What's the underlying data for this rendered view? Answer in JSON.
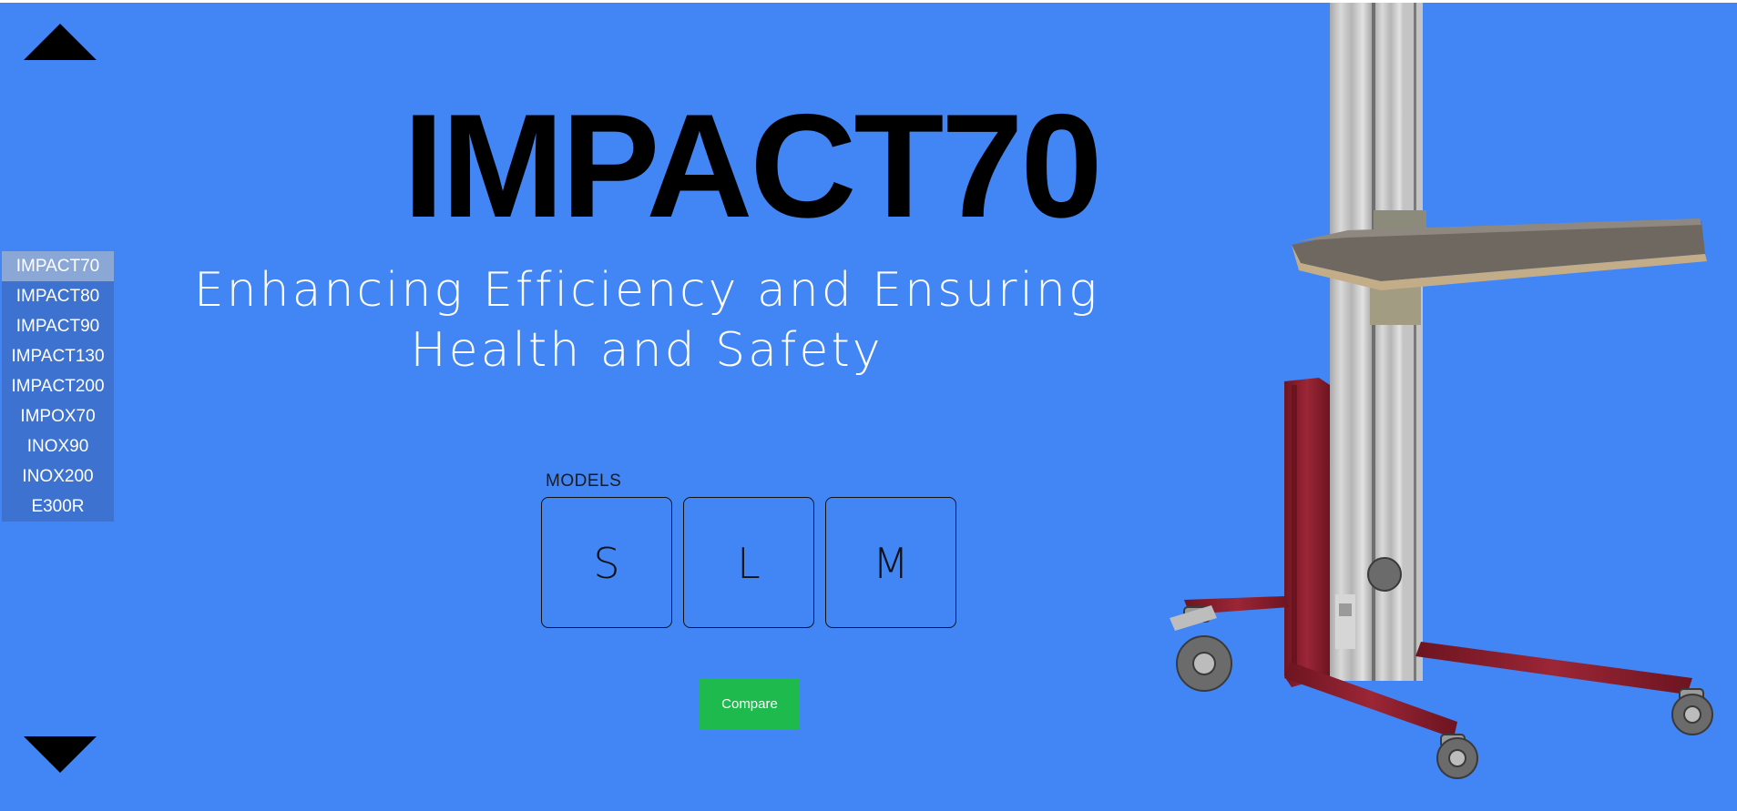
{
  "product": {
    "title": "IMPACT70",
    "subtitle": "Enhancing Efficiency and Ensuring Health and Safety"
  },
  "sidebar": {
    "items": [
      {
        "label": "IMPACT70",
        "active": true
      },
      {
        "label": "IMPACT80",
        "active": false
      },
      {
        "label": "IMPACT90",
        "active": false
      },
      {
        "label": "IMPACT130",
        "active": false
      },
      {
        "label": "IMPACT200",
        "active": false
      },
      {
        "label": "IMPOX70",
        "active": false
      },
      {
        "label": "INOX90",
        "active": false
      },
      {
        "label": "INOX200",
        "active": false
      },
      {
        "label": "E300R",
        "active": false
      }
    ]
  },
  "models": {
    "label": "MODELS",
    "options": [
      "S",
      "L",
      "M"
    ]
  },
  "actions": {
    "compare_label": "Compare"
  },
  "icons": {
    "prev": "triangle-up-icon",
    "next": "triangle-down-icon"
  },
  "colors": {
    "background": "#4285f4",
    "sidebar": "#3d72d0",
    "sidebar_active": "#8ba7d6",
    "compare_button": "#1fba4e",
    "lift_frame": "#8b1e2b",
    "mast": "#c8c8c8"
  }
}
